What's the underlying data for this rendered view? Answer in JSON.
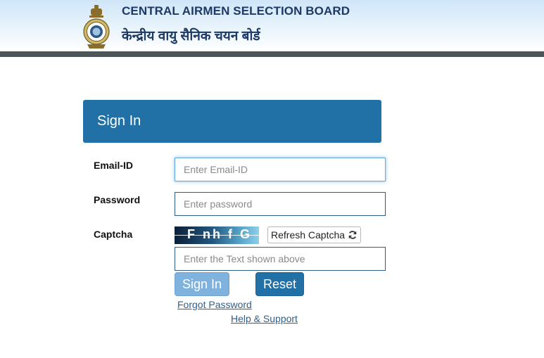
{
  "header": {
    "title_en": "CENTRAL AIRMEN SELECTION BOARD",
    "title_hi": "केन्द्रीय वायु सैनिक चयन बोर्ड",
    "emblem_icon": "air-force-crest-icon"
  },
  "signin": {
    "panel_title": "Sign In",
    "email_label": "Email-ID",
    "email_placeholder": "Enter Email-ID",
    "email_value": "",
    "password_label": "Password",
    "password_placeholder": "Enter password",
    "password_value": "",
    "captcha_label": "Captcha",
    "captcha_text": "F nh f G",
    "refresh_label": "Refresh Captcha",
    "refresh_icon": "refresh-icon",
    "captcha_placeholder": "Enter the Text shown above",
    "captcha_value": "",
    "signin_button": "Sign In",
    "reset_button": "Reset",
    "forgot_link": "Forgot Password",
    "help_link": "Help & Support"
  },
  "colors": {
    "primary": "#2171a6",
    "primary_disabled": "#7fb2dc",
    "header_bar": "#4c5557",
    "title_text": "#1d3a66",
    "link": "#2d5f8c"
  }
}
